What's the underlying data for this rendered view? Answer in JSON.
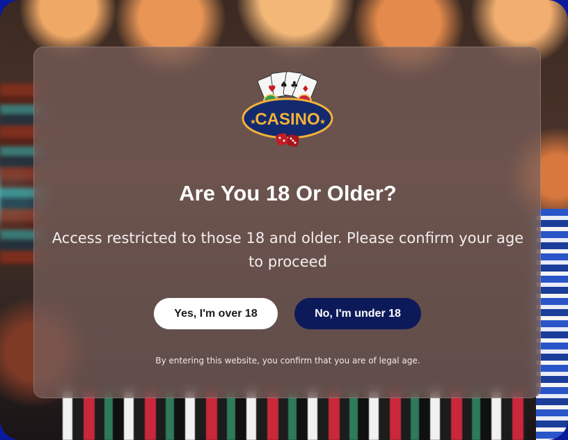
{
  "logo": {
    "text": "CASINO"
  },
  "dialog": {
    "title": "Are You 18 Or Older?",
    "message": "Access restricted to those 18 and older. Please confirm your age to proceed",
    "yes_label": "Yes, I'm over 18",
    "no_label": "No, I'm under 18",
    "footnote": "By entering this website, you confirm that you are of legal age."
  },
  "colors": {
    "frame_border": "#0a1a9c",
    "yes_button_bg": "#ffffff",
    "no_button_bg": "#0d1a5a",
    "logo_badge": "#132a6e",
    "logo_text": "#f3b23a"
  }
}
